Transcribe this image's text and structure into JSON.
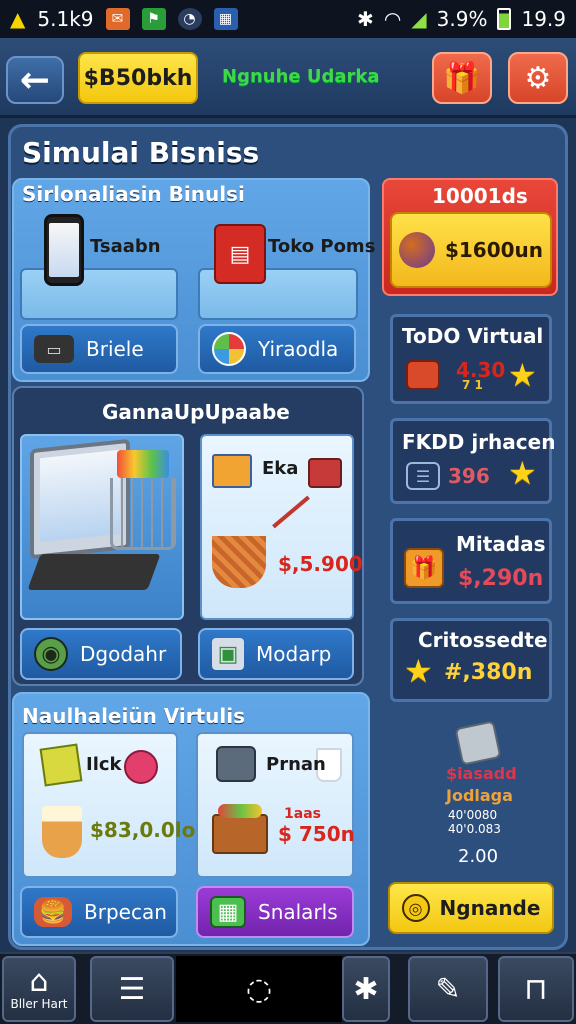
{
  "status_bar": {
    "time": "5.1k9",
    "battery": "3.9%",
    "clock": "19.9"
  },
  "header": {
    "money": "$B50bkh",
    "subtitle": "Ngnuhe Udarka"
  },
  "panel": {
    "title": "Simulai Bisniss"
  },
  "section1": {
    "title": "Sirlonaliasin Binulsi",
    "card_left_label": "Tsaabn",
    "card_right_label": "Toko Poms",
    "btn_left": "Briele",
    "btn_right": "Yiraodla"
  },
  "section2": {
    "title": "GannaUpUpaabe",
    "card_right_label": "Eka",
    "card_right_price": "$,5.900",
    "btn_left": "Dgodahr",
    "btn_right": "Modarp"
  },
  "section3": {
    "title": "Naulhaleiün Virtulis",
    "card_left_label": "Ilck",
    "card_left_price": "$83,0.0lo",
    "card_right_label": "Prnan",
    "card_right_price_top": "1aas",
    "card_right_price": "$ 750n",
    "btn_left": "Brpecan",
    "btn_right": "Snalarls"
  },
  "side": {
    "top_title": "10001ds",
    "top_value": "$1600un",
    "card1_title": "ToDO Virtual",
    "card1_value": "4.30",
    "card1_sub": "7 1",
    "card2_title": "FKDD jrhacen",
    "card2_value": "396",
    "card3_title": "Mitadas",
    "card3_value": "$,290n",
    "card4_title": "Critossedte",
    "card4_value": "#,380n",
    "info_line1": "$iasadd",
    "info_line2": "Jodlaga",
    "info_line3": "40'0080",
    "info_line4": "40'0.083",
    "info_value": "2.00",
    "button": "Ngnande"
  },
  "bottom_nav": {
    "home_label": "Bller Hart"
  },
  "colors": {
    "background": "#1e3556",
    "panel": "#2d4f7e",
    "accent_yellow": "#f3c70d",
    "accent_red": "#d7452a",
    "accent_blue": "#1f5aa2",
    "accent_purple": "#7224ad"
  },
  "icons": [
    "flag-icon",
    "clock-icon",
    "bluetooth-icon",
    "wifi-icon",
    "signal-icon",
    "battery-icon",
    "back-arrow-icon",
    "shop-icon",
    "gear-icon",
    "phone-icon",
    "robot-icon",
    "wallet-icon",
    "color-wheel-icon",
    "laptop-cart-icon",
    "box-icon",
    "basket-icon",
    "cup-icon",
    "fruit-icon",
    "star-icon",
    "gift-icon",
    "home-icon",
    "list-icon",
    "refresh-icon",
    "person-icon",
    "pin-icon",
    "basket-nav-icon"
  ]
}
